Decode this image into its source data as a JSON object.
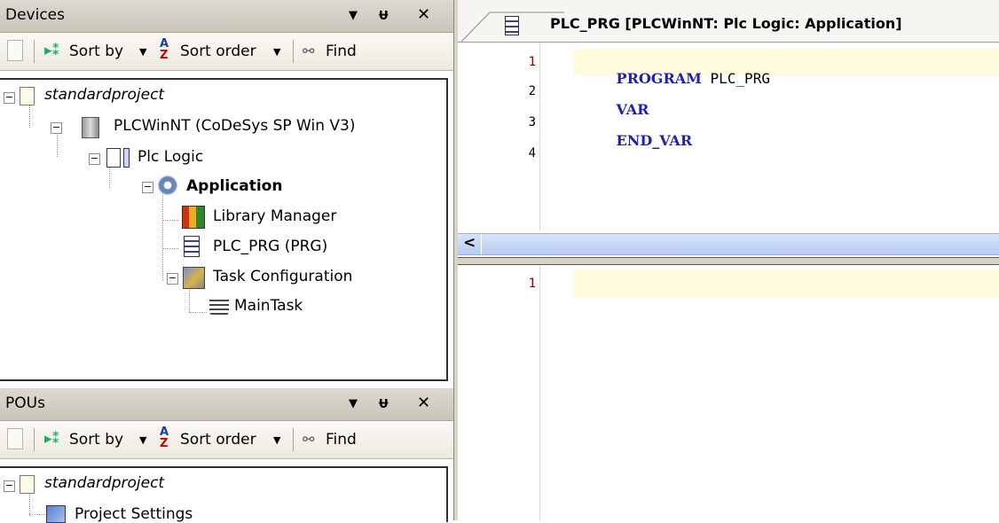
{
  "devices_panel": {
    "title": "Devices",
    "pin_glyph": "ᵾ",
    "close_glyph": "✕",
    "dropdown_glyph": "▼",
    "toolbar": {
      "sort_by": "Sort by",
      "sort_order": "Sort order",
      "find": "Find"
    },
    "tree": {
      "root": "standardproject",
      "device": "PLCWinNT (CoDeSys SP Win V3)",
      "plc_logic": "Plc Logic",
      "application": "Application",
      "library_manager": "Library Manager",
      "plc_prg": "PLC_PRG (PRG)",
      "task_configuration": "Task Configuration",
      "main_task": "MainTask"
    }
  },
  "pous_panel": {
    "title": "POUs",
    "toolbar": {
      "sort_by": "Sort by",
      "sort_order": "Sort order",
      "find": "Find"
    },
    "tree": {
      "root": "standardproject",
      "project_settings": "Project Settings"
    }
  },
  "editor": {
    "tab_title": "PLC_PRG [PLCWinNT: Plc Logic: Application]",
    "declaration": {
      "line_numbers": [
        "1",
        "2",
        "3",
        "4"
      ],
      "lines": [
        {
          "kw": "PROGRAM",
          "rest": " PLC_PRG"
        },
        {
          "kw": "VAR",
          "rest": ""
        },
        {
          "kw": "END_VAR",
          "rest": ""
        }
      ]
    },
    "body": {
      "line_numbers": [
        "1"
      ]
    },
    "scroll_left_glyph": "<"
  },
  "colors": {
    "keyword": "#1f1fb4",
    "current_line": "#fffbdc",
    "scrollbar": "#c7d7f4",
    "line_number_first": "#8b0000"
  },
  "icons": [
    "new-object-icon",
    "sort-icon",
    "sort-order-icon",
    "find-icon",
    "project-icon",
    "device-icon",
    "plc-logic-icon",
    "application-gear-icon",
    "library-books-icon",
    "pou-document-icon",
    "task-config-icon",
    "task-stack-icon",
    "project-settings-icon"
  ]
}
